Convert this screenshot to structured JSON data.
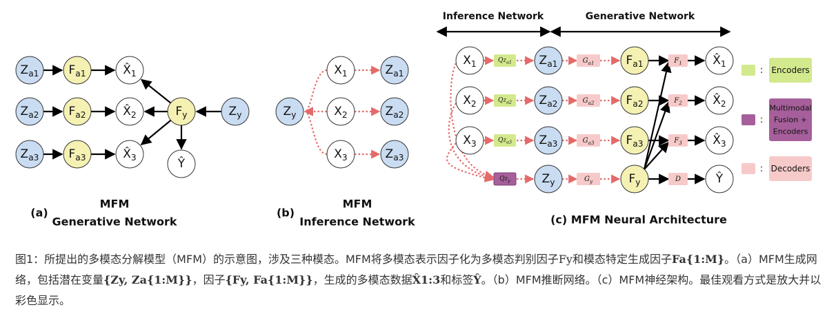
{
  "colors": {
    "latent_blue": "#c9dcf2",
    "factor_yellow": "#f4f1b3",
    "encoder_green": "#d3e98d",
    "fusion_purple": "#a65f9b",
    "decoder_pink": "#f7caca",
    "dotted_red": "#e46a6a"
  },
  "panel_a": {
    "tag": "(a)",
    "title_line1": "MFM",
    "title_line2": "Generative Network",
    "nodes": {
      "za1": "Z_a1",
      "za2": "Z_a2",
      "za3": "Z_a3",
      "fa1": "F_a1",
      "fa2": "F_a2",
      "fa3": "F_a3",
      "x1": "X̂_1",
      "x2": "X̂_2",
      "x3": "X̂_3",
      "fy": "F_y",
      "zy": "Z_y",
      "y": "Ŷ"
    }
  },
  "panel_b": {
    "tag": "(b)",
    "title_line1": "MFM",
    "title_line2": "Inference Network",
    "nodes": {
      "zy": "Z_y",
      "x1": "X_1",
      "x2": "X_2",
      "x3": "X_3",
      "za1": "Z_a1",
      "za2": "Z_a2",
      "za3": "Z_a3"
    }
  },
  "panel_c": {
    "caption": "(c) MFM Neural Architecture",
    "header_inference": "Inference Network",
    "header_generative": "Generative Network",
    "inputs": [
      "X_1",
      "X_2",
      "X_3"
    ],
    "encoders": [
      "Qz_a1",
      "Qz_a2",
      "Qz_a3",
      "Qz_y"
    ],
    "latents": [
      "Z_a1",
      "Z_a2",
      "Z_a3",
      "Z_y"
    ],
    "generators": [
      "G_a1",
      "G_a2",
      "G_a3",
      "G_y"
    ],
    "factors": [
      "F_a1",
      "F_a2",
      "F_a3",
      "F_y"
    ],
    "fusions": [
      "F_1",
      "F_2",
      "F_3",
      "D"
    ],
    "outputs": [
      "X̂_1",
      "X̂_2",
      "X̂_3",
      "Ŷ"
    ]
  },
  "legend": {
    "separator": ":",
    "encoders": "Encoders",
    "fusion": "Multimodal Fusion + Encoders",
    "decoders": "Decoders"
  },
  "caption": {
    "part1": "图1：所提出的多模态分解模型（MFM）的示意图，涉及三种模态。MFM将多模态表示因子化为多模态判别因子",
    "f_y": "Fy",
    "part2": "和模态特定生成因子",
    "f_a": "Fa{1:M}",
    "part3": "。（a）MFM生成网络，包括潜在变量",
    "latent_set": "{Zy, Za{1:M}}",
    "part4": "，因子",
    "factor_set": "{Fy, Fa{1:M}}",
    "part5": "，生成的多模态数据",
    "x_hat": "X̂1:3",
    "part6": "和标签",
    "y_hat": "Ŷ",
    "part7": "。（b）MFM推断网络。（c）MFM神经架构。最佳观看方式是放大并以彩色显示。"
  }
}
